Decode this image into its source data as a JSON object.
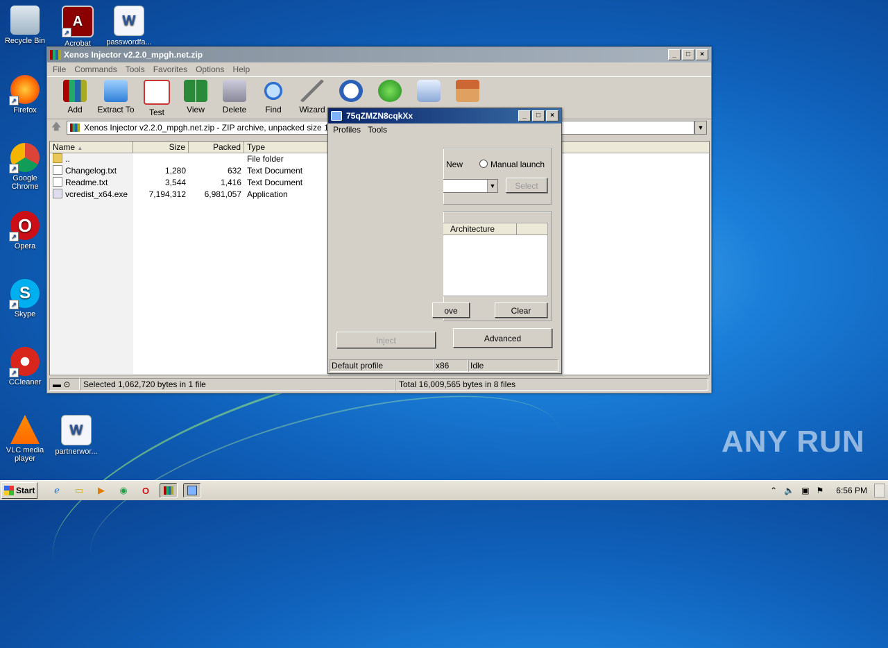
{
  "desktop": {
    "icons": [
      {
        "label": "Recycle Bin"
      },
      {
        "label": "Acrobat"
      },
      {
        "label": "passwordfa..."
      },
      {
        "label": "Firefox"
      },
      {
        "label": "Google Chrome"
      },
      {
        "label": "Opera"
      },
      {
        "label": "Skype"
      },
      {
        "label": "CCleaner"
      },
      {
        "label": "VLC media player"
      },
      {
        "label": "partnerwor..."
      }
    ]
  },
  "winrar": {
    "title": "Xenos Injector v2.2.0_mpgh.net.zip",
    "menu": [
      "File",
      "Commands",
      "Tools",
      "Favorites",
      "Options",
      "Help"
    ],
    "toolbar": [
      "Add",
      "Extract To",
      "Test",
      "View",
      "Delete",
      "Find",
      "Wizard"
    ],
    "address": "Xenos Injector v2.2.0_mpgh.net.zip - ZIP archive, unpacked size 16",
    "columns": [
      "Name",
      "Size",
      "Packed",
      "Type"
    ],
    "rows": [
      {
        "name": "..",
        "size": "",
        "packed": "",
        "type": "File folder"
      },
      {
        "name": "Changelog.txt",
        "size": "1,280",
        "packed": "632",
        "type": "Text Document"
      },
      {
        "name": "Readme.txt",
        "size": "3,544",
        "packed": "1,416",
        "type": "Text Document"
      },
      {
        "name": "vcredist_x64.exe",
        "size": "7,194,312",
        "packed": "6,981,057",
        "type": "Application"
      }
    ],
    "status_left": "Selected 1,062,720 bytes in 1 file",
    "status_right": "Total 16,009,565 bytes in 8 files"
  },
  "xenos": {
    "title": "75qZMZN8cqkXx",
    "menu": [
      "Profiles",
      "Tools"
    ],
    "radio_new": "New",
    "radio_manual": "Manual launch",
    "select_button": "Select",
    "column_architecture": "Architecture",
    "remove_button": "ove",
    "clear_button": "Clear",
    "inject_button": "Inject",
    "advanced_button": "Advanced",
    "status": [
      "Default profile",
      "x86",
      "Idle"
    ]
  },
  "taskbar": {
    "start": "Start",
    "clock": "6:56 PM"
  },
  "watermark": "ANY RUN"
}
